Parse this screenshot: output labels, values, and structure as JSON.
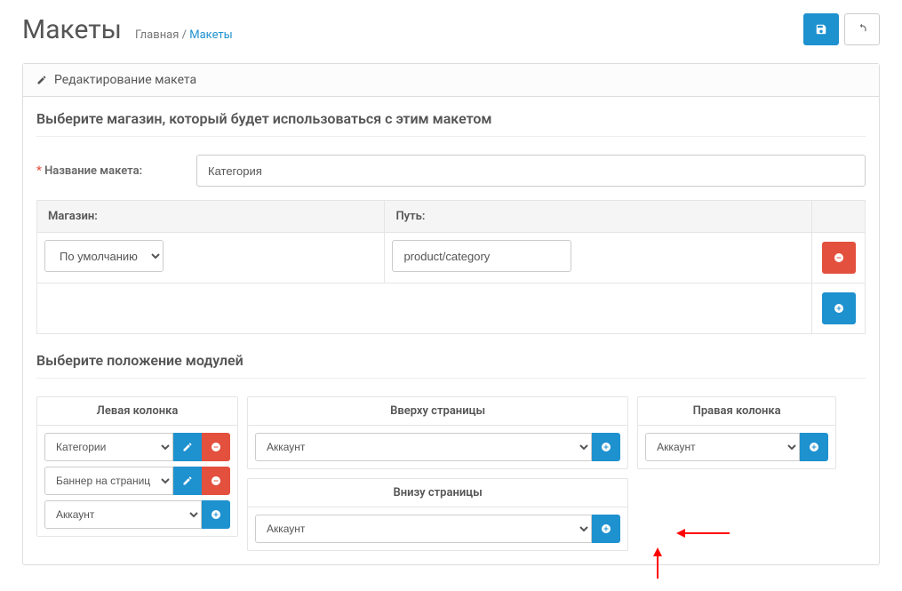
{
  "header": {
    "title": "Макеты",
    "breadcrumb_home": "Главная",
    "breadcrumb_sep": " / ",
    "breadcrumb_current": "Макеты"
  },
  "panel": {
    "title": "Редактирование макета"
  },
  "form": {
    "store_legend": "Выберите магазин, который будет использоваться с этим макетом",
    "name_label": "Название макета:",
    "name_value": "Категория",
    "route": {
      "header_store": "Магазин:",
      "header_path": "Путь:",
      "store_selected": "По умолчанию",
      "path_value": "product/category"
    },
    "modules_legend": "Выберите положение модулей",
    "columns": {
      "left": {
        "title": "Левая колонка",
        "rows": [
          {
            "value": "Категории",
            "edit": true,
            "remove": true
          },
          {
            "value": "Баннер на страниц",
            "edit": true,
            "remove": true
          },
          {
            "value": "Аккаунт",
            "add": true
          }
        ]
      },
      "content_top": {
        "title": "Вверху страницы",
        "rows": [
          {
            "value": "Аккаунт",
            "add": true
          }
        ]
      },
      "content_bottom": {
        "title": "Внизу страницы",
        "rows": [
          {
            "value": "Аккаунт",
            "add": true
          }
        ]
      },
      "right": {
        "title": "Правая колонка",
        "rows": [
          {
            "value": "Аккаунт",
            "add": true
          }
        ]
      }
    }
  }
}
